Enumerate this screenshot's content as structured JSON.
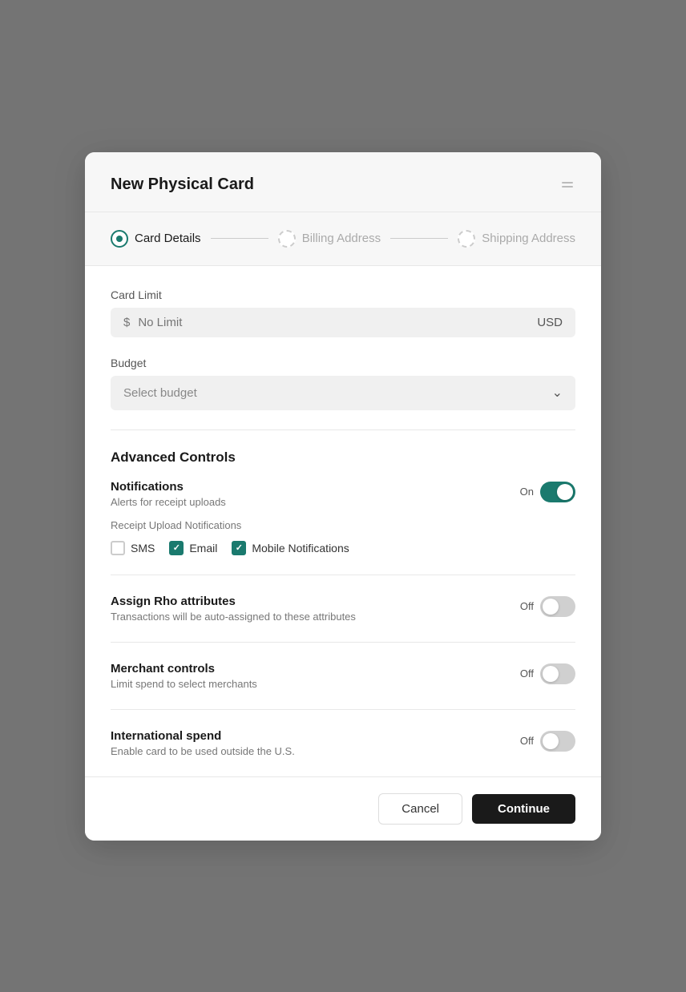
{
  "modal": {
    "title": "New Physical Card",
    "header_icon": "⊟"
  },
  "stepper": {
    "step1_label": "Card Details",
    "step2_label": "Billing Address",
    "step3_label": "Shipping Address",
    "active_step": 1
  },
  "card_limit": {
    "label": "Card Limit",
    "placeholder": "No Limit",
    "currency_symbol": "$",
    "currency_code": "USD"
  },
  "budget": {
    "label": "Budget",
    "placeholder": "Select budget"
  },
  "advanced": {
    "title": "Advanced Controls",
    "notifications": {
      "title": "Notifications",
      "description": "Alerts for receipt uploads",
      "state": "On",
      "enabled": true,
      "receipt_label": "Receipt Upload Notifications",
      "checkboxes": [
        {
          "label": "SMS",
          "checked": false
        },
        {
          "label": "Email",
          "checked": true
        },
        {
          "label": "Mobile Notifications",
          "checked": true
        }
      ]
    },
    "assign_rho": {
      "title": "Assign Rho attributes",
      "description": "Transactions will be auto-assigned to these attributes",
      "state": "Off",
      "enabled": false
    },
    "merchant_controls": {
      "title": "Merchant controls",
      "description": "Limit spend to select merchants",
      "state": "Off",
      "enabled": false
    },
    "international_spend": {
      "title": "International spend",
      "description": "Enable card to be used outside the U.S.",
      "state": "Off",
      "enabled": false
    }
  },
  "footer": {
    "cancel_label": "Cancel",
    "continue_label": "Continue"
  }
}
